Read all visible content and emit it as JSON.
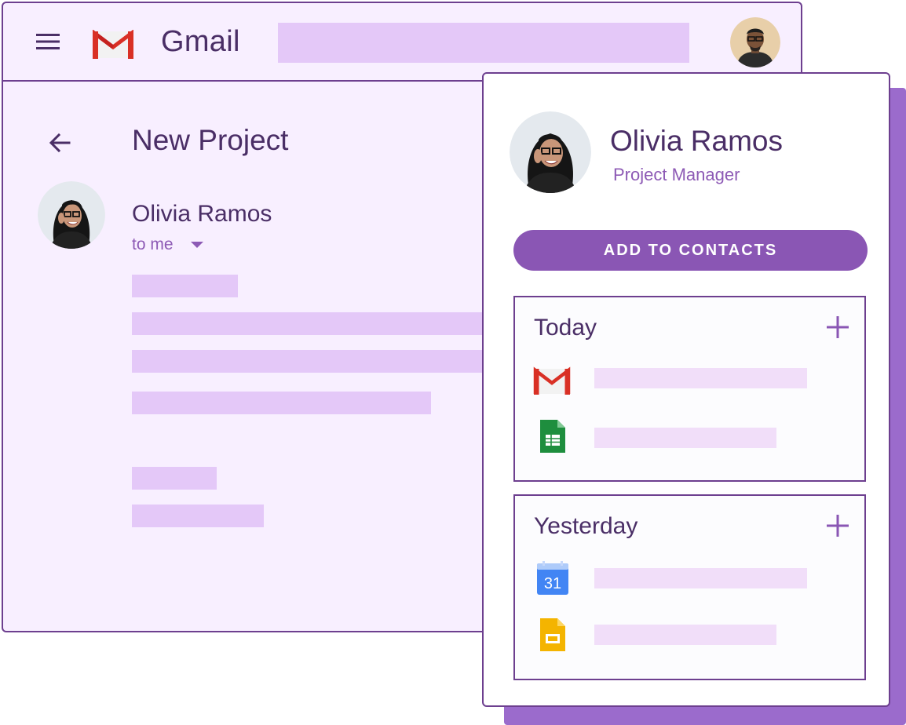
{
  "gmail": {
    "app_title": "Gmail",
    "email": {
      "subject": "New Project",
      "sender_name": "Olivia Ramos",
      "recipient": "to me"
    }
  },
  "contact_card": {
    "name": "Olivia Ramos",
    "role": "Project Manager",
    "add_button_label": "ADD TO CONTACTS",
    "sections": [
      {
        "title": "Today",
        "items": [
          "gmail-icon",
          "sheets-icon"
        ]
      },
      {
        "title": "Yesterday",
        "items": [
          "calendar-icon",
          "slides-icon"
        ]
      }
    ],
    "calendar_day": "31"
  },
  "colors": {
    "accent": "#8a56b4",
    "border": "#6d3f8f",
    "text": "#4a2e66",
    "placeholder": "#e4c8f8",
    "window_bg": "#f8efff",
    "shadow": "#9b6bcc"
  }
}
